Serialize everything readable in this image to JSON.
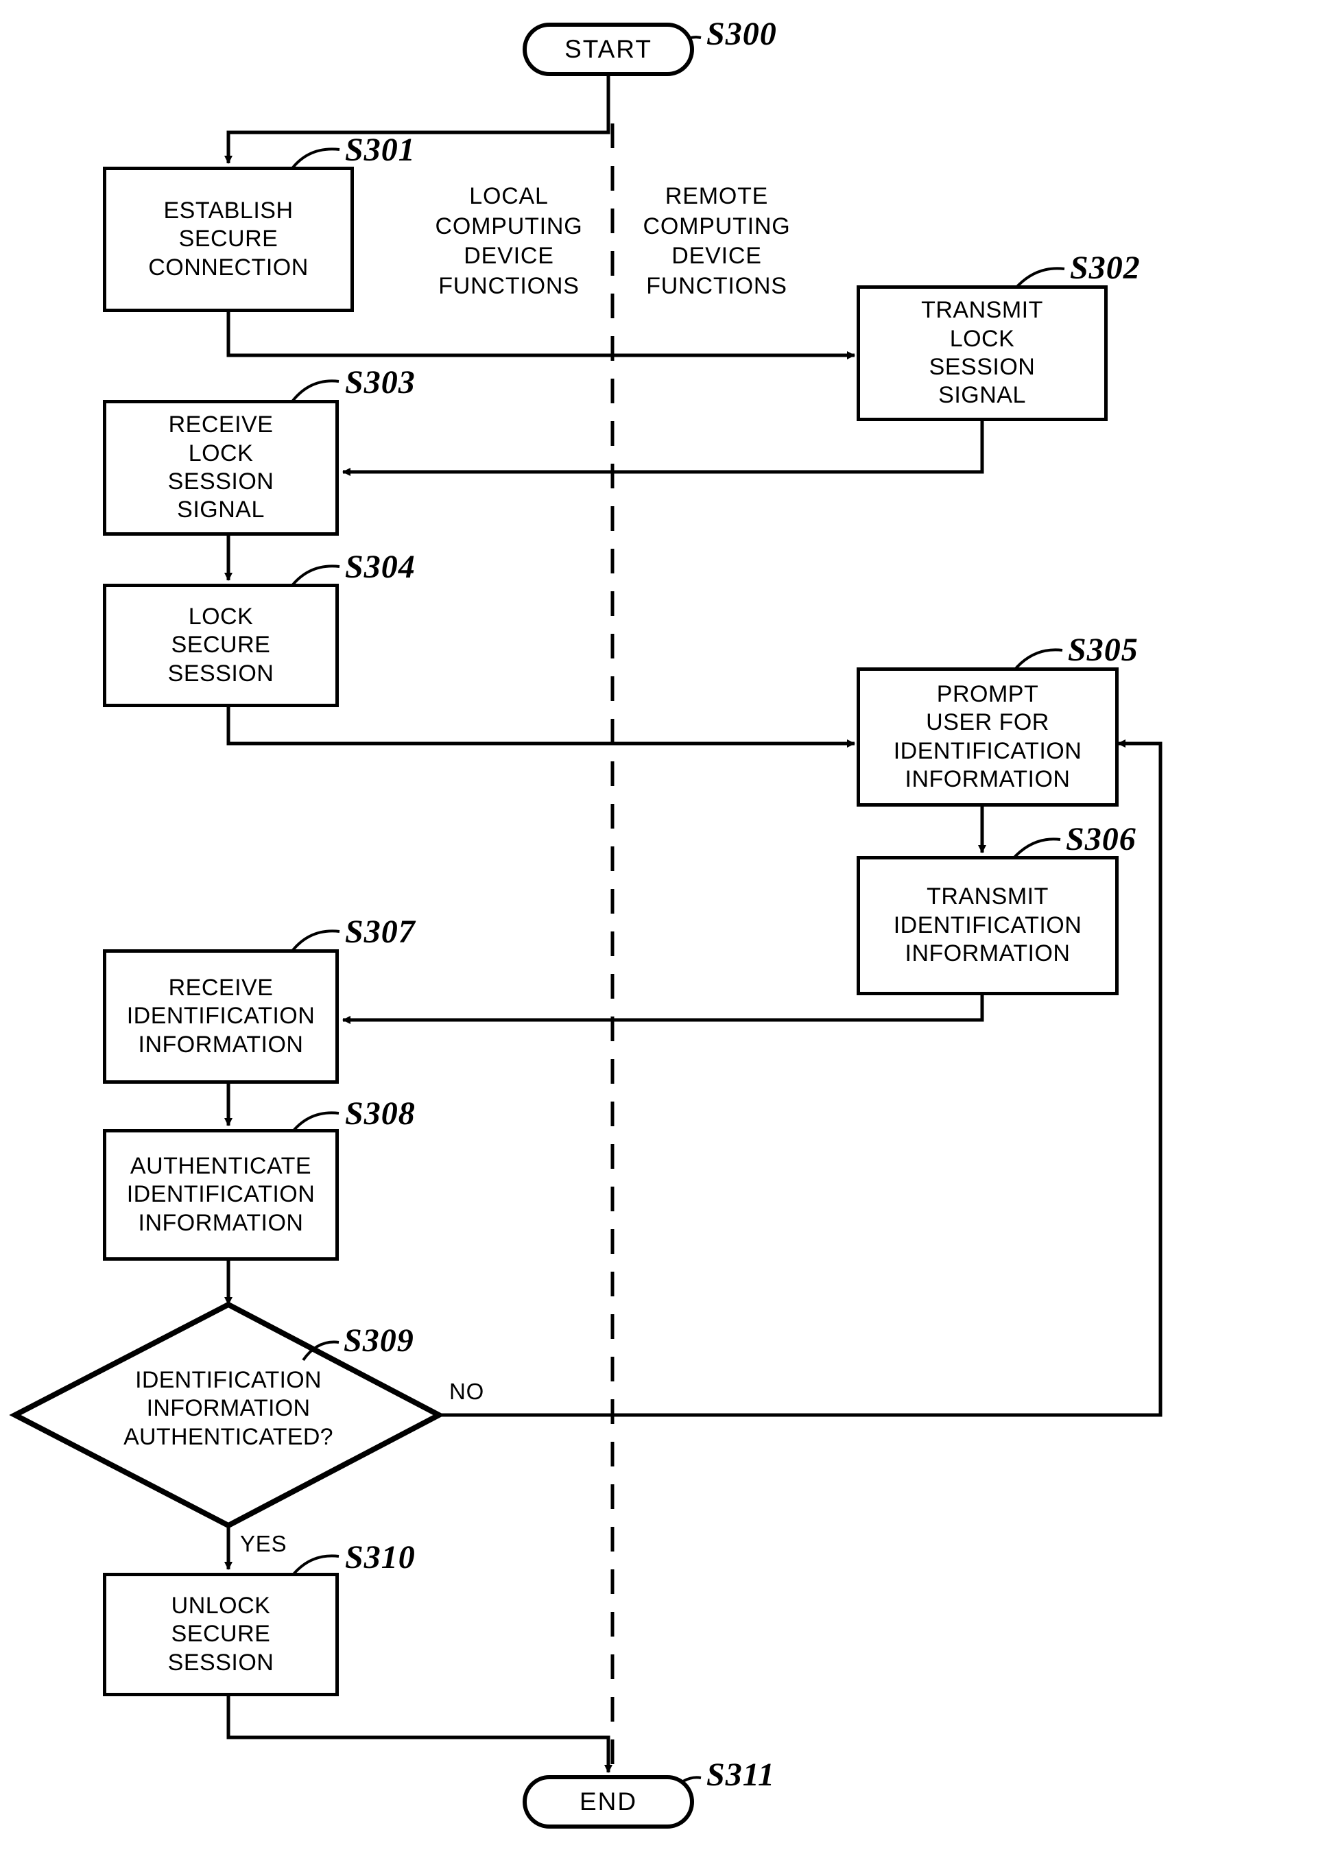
{
  "figure": {
    "title": "Secure session lock and unlock process flowchart",
    "lanes": [
      {
        "id": "local",
        "lines": [
          "LOCAL",
          "COMPUTING",
          "DEVICE",
          "FUNCTIONS"
        ]
      },
      {
        "id": "remote",
        "lines": [
          "REMOTE",
          "COMPUTING",
          "DEVICE",
          "FUNCTIONS"
        ]
      }
    ],
    "nodes": [
      {
        "id": "start",
        "kind": "terminator",
        "ref": "S300",
        "lines": [
          "START"
        ]
      },
      {
        "id": "s301",
        "kind": "process",
        "ref": "S301",
        "lines": [
          "ESTABLISH",
          "SECURE",
          "CONNECTION"
        ]
      },
      {
        "id": "s302",
        "kind": "process",
        "ref": "S302",
        "lines": [
          "TRANSMIT",
          "LOCK",
          "SESSION",
          "SIGNAL"
        ]
      },
      {
        "id": "s303",
        "kind": "process",
        "ref": "S303",
        "lines": [
          "RECEIVE",
          "LOCK",
          "SESSION",
          "SIGNAL"
        ]
      },
      {
        "id": "s304",
        "kind": "process",
        "ref": "S304",
        "lines": [
          "LOCK",
          "SECURE",
          "SESSION"
        ]
      },
      {
        "id": "s305",
        "kind": "process",
        "ref": "S305",
        "lines": [
          "PROMPT",
          "USER  FOR",
          "IDENTIFICATION",
          "INFORMATION"
        ]
      },
      {
        "id": "s306",
        "kind": "process",
        "ref": "S306",
        "lines": [
          "TRANSMIT",
          "IDENTIFICATION",
          "INFORMATION"
        ]
      },
      {
        "id": "s307",
        "kind": "process",
        "ref": "S307",
        "lines": [
          "RECEIVE",
          "IDENTIFICATION",
          "INFORMATION"
        ]
      },
      {
        "id": "s308",
        "kind": "process",
        "ref": "S308",
        "lines": [
          "AUTHENTICATE",
          "IDENTIFICATION",
          "INFORMATION"
        ]
      },
      {
        "id": "s309",
        "kind": "decision",
        "ref": "S309",
        "lines": [
          "IDENTIFICATION",
          "INFORMATION",
          "AUTHENTICATED?"
        ]
      },
      {
        "id": "s310",
        "kind": "process",
        "ref": "S310",
        "lines": [
          "UNLOCK",
          "SECURE",
          "SESSION"
        ]
      },
      {
        "id": "end",
        "kind": "terminator",
        "ref": "S311",
        "lines": [
          "END"
        ]
      }
    ],
    "branch_labels": [
      {
        "id": "no",
        "text": "NO"
      },
      {
        "id": "yes",
        "text": "YES"
      }
    ],
    "colors": {
      "stroke": "#000000",
      "fill": "#ffffff",
      "text": "#000000"
    }
  }
}
